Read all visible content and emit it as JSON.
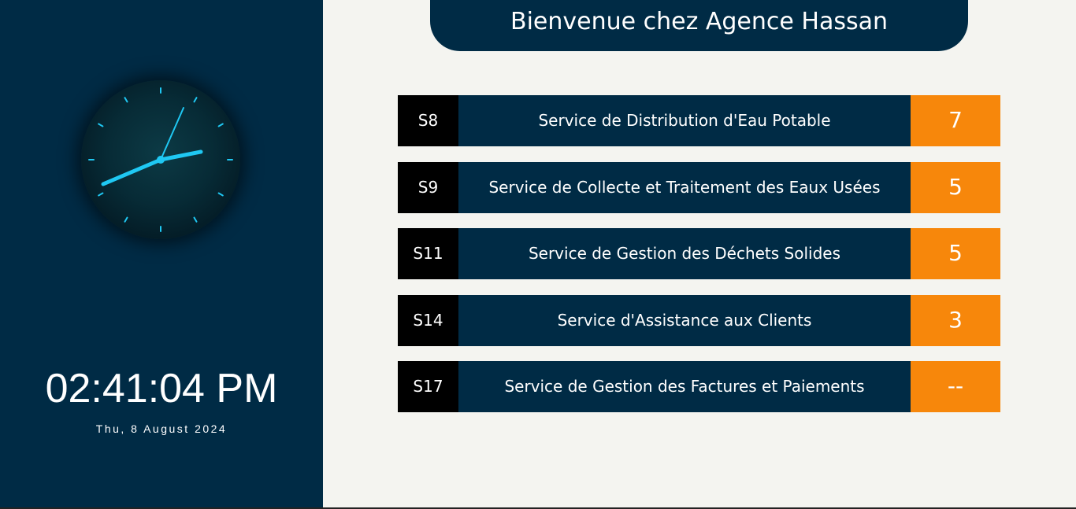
{
  "header": {
    "title": "Bienvenue chez Agence Hassan"
  },
  "clock": {
    "time": "02:41:04 PM",
    "date": "Thu, 8 August 2024",
    "accent_color": "#1fc8f3"
  },
  "services": [
    {
      "code": "S8",
      "name": "Service de Distribution d'Eau Potable",
      "count": "7"
    },
    {
      "code": "S9",
      "name": "Service de Collecte et Traitement des Eaux Usées",
      "count": "5"
    },
    {
      "code": "S11",
      "name": "Service de Gestion des Déchets Solides",
      "count": "5"
    },
    {
      "code": "S14",
      "name": "Service d'Assistance aux Clients",
      "count": "3"
    },
    {
      "code": "S17",
      "name": "Service de Gestion des Factures et Paiements",
      "count": "--"
    }
  ],
  "colors": {
    "navy": "#002b45",
    "orange": "#f7870b",
    "code_bg": "#000000",
    "page_bg": "#f4f4f0"
  }
}
